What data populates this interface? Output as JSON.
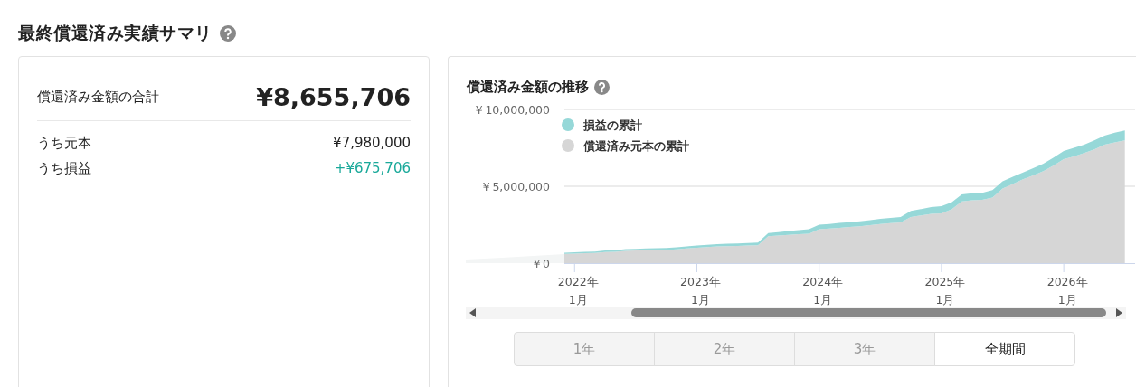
{
  "title": "最終償還済み実績サマリ",
  "summary": {
    "total_label": "償還済み金額の合計",
    "total_value": "¥8,655,706",
    "rows": [
      {
        "label": "うち元本",
        "value": "¥7,980,000",
        "kind": "plain"
      },
      {
        "label": "うち損益",
        "value": "+¥675,706",
        "kind": "gain"
      }
    ]
  },
  "trend": {
    "title": "償還済み金額の推移",
    "chart_data": {
      "type": "area",
      "stacked": true,
      "x": [
        "2021-12",
        "2022-01",
        "2022-02",
        "2022-03",
        "2022-04",
        "2022-05",
        "2022-06",
        "2022-07",
        "2022-08",
        "2022-09",
        "2022-10",
        "2022-11",
        "2022-12",
        "2023-01",
        "2023-02",
        "2023-03",
        "2023-04",
        "2023-05",
        "2023-06",
        "2023-07",
        "2023-08",
        "2023-09",
        "2023-10",
        "2023-11",
        "2023-12",
        "2024-01",
        "2024-02",
        "2024-03",
        "2024-04",
        "2024-05",
        "2024-06",
        "2024-07",
        "2024-08",
        "2024-09",
        "2024-10",
        "2024-11",
        "2024-12",
        "2025-01",
        "2025-02",
        "2025-03",
        "2025-04",
        "2025-05",
        "2025-06",
        "2025-07",
        "2025-08",
        "2025-09",
        "2025-10",
        "2025-11",
        "2025-12",
        "2026-01",
        "2026-02",
        "2026-03",
        "2026-04",
        "2026-05",
        "2026-06",
        "2026-07"
      ],
      "series": [
        {
          "name": "償還済み元本の累計",
          "color": "#d6d6d6",
          "values": [
            600000,
            620000,
            640000,
            660000,
            720000,
            740000,
            800000,
            820000,
            840000,
            850000,
            860000,
            900000,
            950000,
            1000000,
            1040000,
            1080000,
            1100000,
            1120000,
            1140000,
            1160000,
            1750000,
            1800000,
            1840000,
            1880000,
            1920000,
            2200000,
            2250000,
            2300000,
            2350000,
            2400000,
            2470000,
            2550000,
            2600000,
            2650000,
            3000000,
            3100000,
            3200000,
            3240000,
            3500000,
            4020000,
            4080000,
            4120000,
            4270000,
            4860000,
            5150000,
            5450000,
            5700000,
            5980000,
            6350000,
            6760000,
            6950000,
            7160000,
            7400000,
            7700000,
            7850000,
            7980000
          ]
        },
        {
          "name": "損益の累計",
          "color": "#96d8d8",
          "values": [
            80000,
            80000,
            90000,
            90000,
            100000,
            100000,
            110000,
            110000,
            120000,
            120000,
            130000,
            130000,
            140000,
            140000,
            150000,
            150000,
            160000,
            160000,
            170000,
            180000,
            200000,
            220000,
            240000,
            260000,
            280000,
            300000,
            300000,
            310000,
            310000,
            320000,
            320000,
            330000,
            340000,
            350000,
            400000,
            420000,
            450000,
            470000,
            450000,
            450000,
            460000,
            450000,
            480000,
            470000,
            460000,
            450000,
            470000,
            490000,
            520000,
            540000,
            550000,
            550000,
            580000,
            600000,
            630000,
            650000
          ]
        }
      ],
      "legend": [
        "損益の累計",
        "償還済み元本の累計"
      ],
      "xlim": [
        "2021-12",
        "2026-08"
      ],
      "ylim": [
        0,
        10000000
      ],
      "yticks": [
        {
          "value": 0,
          "label": "￥0"
        },
        {
          "value": 5000000,
          "label": "￥5,000,000"
        },
        {
          "value": 10000000,
          "label": "￥10,000,000"
        }
      ],
      "xticks": [
        {
          "value": "2022-01",
          "label": "2022年 1月"
        },
        {
          "value": "2023-01",
          "label": "2023年 1月"
        },
        {
          "value": "2024-01",
          "label": "2024年 1月"
        },
        {
          "value": "2025-01",
          "label": "2025年 1月"
        },
        {
          "value": "2026-01",
          "label": "2026年 1月"
        }
      ]
    },
    "periods": [
      {
        "label": "1年",
        "selected": false
      },
      {
        "label": "2年",
        "selected": false
      },
      {
        "label": "3年",
        "selected": false
      },
      {
        "label": "全期間",
        "selected": true
      }
    ]
  }
}
